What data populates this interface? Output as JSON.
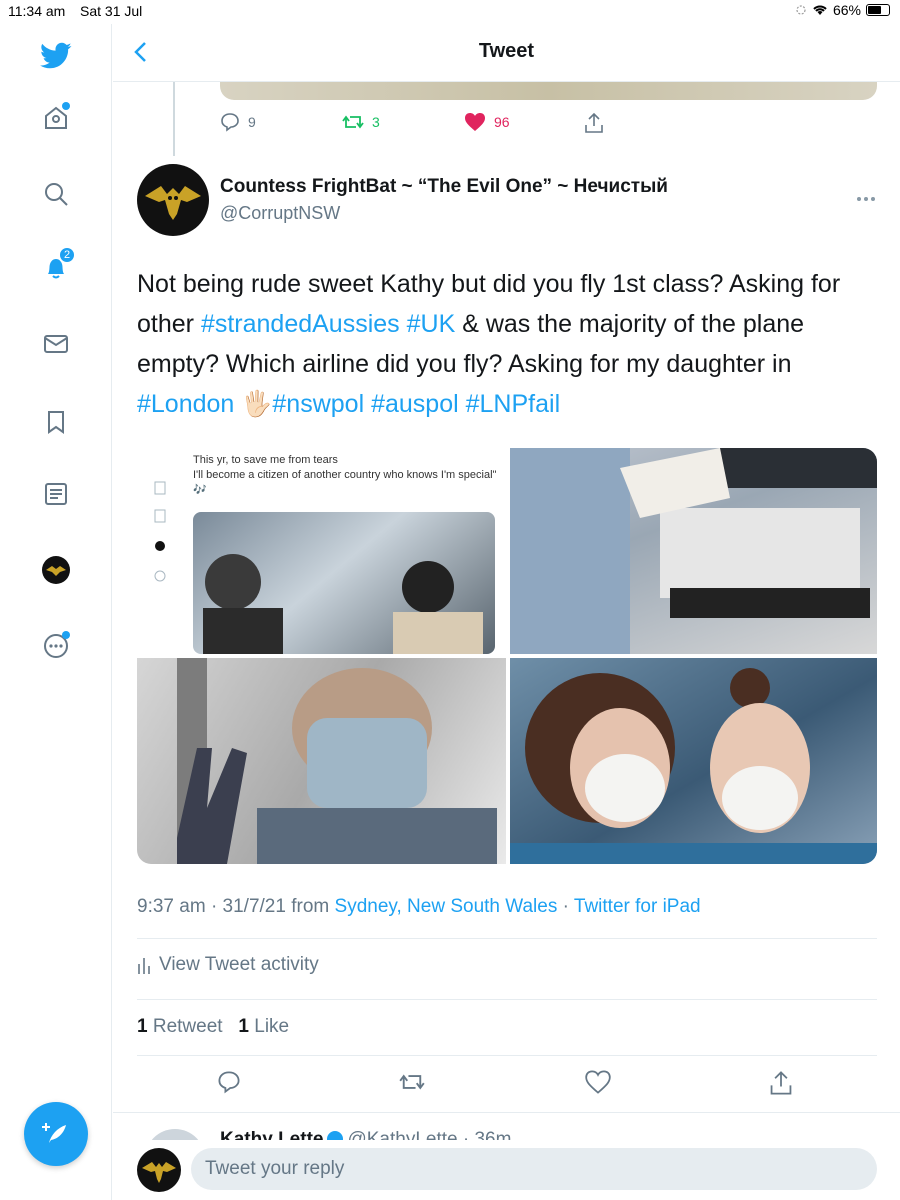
{
  "status_bar": {
    "time": "11:34 am",
    "date": "Sat 31 Jul",
    "battery": "66%",
    "battery_level": 0.66
  },
  "sidebar": {
    "notification_count": "2",
    "items": [
      {
        "name": "home-icon"
      },
      {
        "name": "explore-icon"
      },
      {
        "name": "notifications-icon"
      },
      {
        "name": "messages-icon"
      },
      {
        "name": "bookmarks-icon"
      },
      {
        "name": "lists-icon"
      },
      {
        "name": "profile-icon"
      },
      {
        "name": "more-icon"
      }
    ],
    "compose_icon": "feather-plus-icon"
  },
  "header": {
    "title": "Tweet"
  },
  "previous_tweet": {
    "replies": "9",
    "retweets": "3",
    "likes": "96"
  },
  "tweet": {
    "author_name": "Countess FrightBat ~ “The Evil One” ~ Нечистый",
    "author_handle": "@CorruptNSW",
    "text_segments": [
      {
        "t": "Not being rude sweet Kathy but did you fly 1st class? Asking for other ",
        "tag": false
      },
      {
        "t": "#strandedAussies",
        "tag": true
      },
      {
        "t": " ",
        "tag": false
      },
      {
        "t": "#UK",
        "tag": true
      },
      {
        "t": " & was the majority of the plane empty? Which airline did you fly? Asking for my daughter in ",
        "tag": false
      },
      {
        "t": "#London",
        "tag": true
      },
      {
        "t": " 🖐🏻",
        "tag": false
      },
      {
        "t": "#nswpol",
        "tag": true
      },
      {
        "t": " ",
        "tag": false
      },
      {
        "t": "#auspol",
        "tag": true
      },
      {
        "t": " ",
        "tag": false
      },
      {
        "t": "#LNPfail",
        "tag": true
      }
    ],
    "media": {
      "screenshot_lines": [
        "This yr, to save me from tears",
        "I'll become a citizen of another country who knows I'm special\"",
        "🎶"
      ]
    },
    "time": "9:37 am",
    "date": "31/7/21",
    "from_label": "from",
    "location": "Sydney, New South Wales",
    "separator": "·",
    "client": "Twitter for iPad",
    "activity_label": "View Tweet activity",
    "retweet_count": "1",
    "retweet_label": "Retweet",
    "like_count": "1",
    "like_label": "Like"
  },
  "next_tweet": {
    "name": "Kathy Lette",
    "handle": "@KathyLette · 36m"
  },
  "reply": {
    "placeholder": "Tweet your reply"
  },
  "colors": {
    "accent": "#1da1f2",
    "like": "#e0245e",
    "retweet": "#17bf63",
    "secondary": "#657786"
  }
}
